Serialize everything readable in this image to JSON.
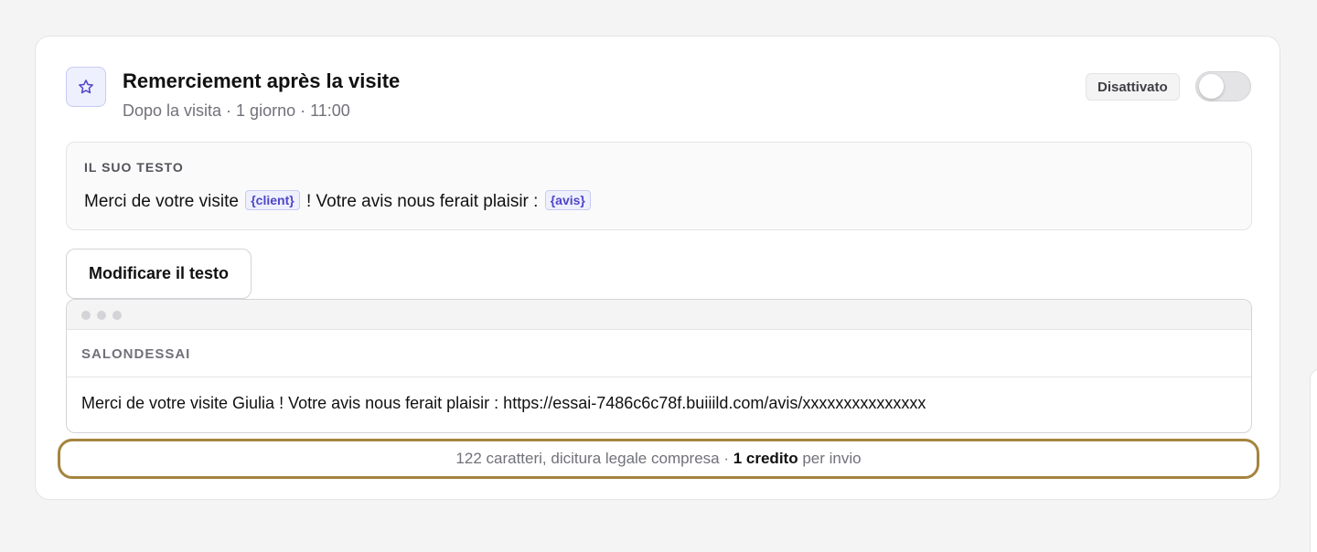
{
  "card": {
    "icon": "star-icon",
    "title": "Remerciement après la visite",
    "subtitle": "Dopo la visita · 1 giorno · 11:00",
    "status": "Disattivato",
    "toggle_on": false
  },
  "text_panel": {
    "label": "IL SUO TESTO",
    "text_1": "Merci de votre visite ",
    "var_1": "{client}",
    "text_2": " ! Votre avis nous ferait plaisir : ",
    "var_2": "{avis}"
  },
  "edit_button": "Modificare il testo",
  "preview": {
    "sender": "SALONDESSAI",
    "message": "Merci de votre visite Giulia ! Votre avis nous ferait plaisir : https://essai-7486c6c78f.buiiild.com/avis/xxxxxxxxxxxxxxx"
  },
  "counter": {
    "prefix": "122 caratteri, dicitura legale compresa · ",
    "credits": "1 credito",
    "suffix": " per invio"
  },
  "colors": {
    "accent": "#4f46c8",
    "highlight_border": "#a4843f"
  }
}
